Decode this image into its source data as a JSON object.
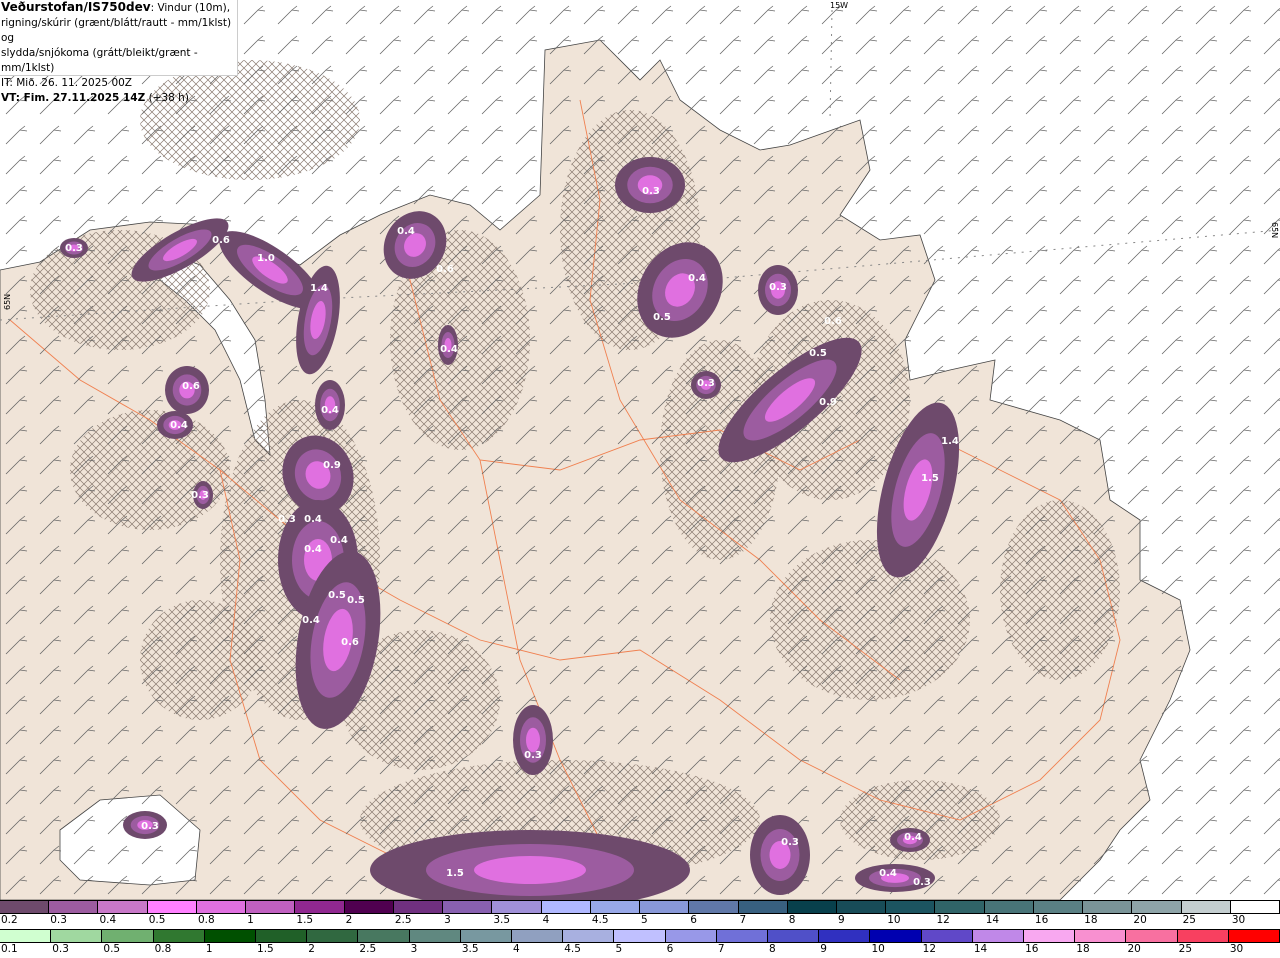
{
  "header": {
    "brand": "Veðurstofan/IS750dev",
    "line1_rest": ": Vindur (10m),",
    "line2": "rigning/skúrir (grænt/blátt/rautt - mm/1klst) og",
    "line3": "slydda/snjókoma (grátt/bleikt/grænt - mm/1klst)",
    "init_time": "IT: Mið. 26. 11. 2025 00Z",
    "valid_label": "VT: Fim. 27.11.2025 14Z",
    "valid_offset": "(+38 h)"
  },
  "map": {
    "graticule_labels": {
      "top": "15W",
      "left": "65N",
      "right": "65N"
    },
    "colors": {
      "land": "#f0e4d8",
      "sea": "#ffffff",
      "roads": "#f08050",
      "wind_barbs": "#555555",
      "hatch": "#8a7a70"
    },
    "precip_values": [
      "0.3",
      "0.6",
      "1.0",
      "1.4",
      "0.4",
      "0.6",
      "0.4",
      "0.6",
      "0.4",
      "0.4",
      "0.9",
      "0.3",
      "0.3",
      "0.4",
      "0.4",
      "0.4",
      "0.5",
      "0.5",
      "0.4",
      "0.6",
      "0.3",
      "0.4",
      "0.5",
      "0.3",
      "0.3",
      "0.6",
      "0.5",
      "0.9",
      "1.4",
      "1.5",
      "0.3",
      "0.3",
      "1.5",
      "0.3",
      "0.4",
      "0.4",
      "0.3"
    ]
  },
  "legend": {
    "snow": {
      "labels": [
        "0.2",
        "0.3",
        "0.4",
        "0.5",
        "0.8",
        "1",
        "1.5",
        "2",
        "2.5",
        "3",
        "3.5",
        "4",
        "4.5",
        "5",
        "6",
        "7",
        "8",
        "9",
        "10",
        "12",
        "14",
        "16",
        "18",
        "20",
        "25",
        "30"
      ],
      "colors": [
        "#6e4a6c",
        "#9c5ca0",
        "#c878c8",
        "#ff80ff",
        "#e070e0",
        "#c060c0",
        "#902890",
        "#500050",
        "#703080",
        "#8860b0",
        "#a090d8",
        "#b0b8ff",
        "#98a8e8",
        "#8898d8",
        "#6078a8",
        "#386080",
        "#08404c",
        "#184c58",
        "#1c5460",
        "#306468",
        "#487478",
        "#5a8084",
        "#7a9498",
        "#8ea4a8",
        "#c4ced0",
        "#ffffff"
      ]
    },
    "rain": {
      "labels": [
        "0.1",
        "0.3",
        "0.5",
        "0.8",
        "1",
        "1.5",
        "2",
        "2.5",
        "3",
        "3.5",
        "4",
        "4.5",
        "5",
        "6",
        "7",
        "8",
        "9",
        "10",
        "12",
        "14",
        "16",
        "18",
        "20",
        "25",
        "30"
      ],
      "colors": [
        "#d0ffd0",
        "#a0d8a0",
        "#70b070",
        "#307830",
        "#005000",
        "#206028",
        "#306840",
        "#487860",
        "#608880",
        "#7898a0",
        "#90a0c0",
        "#a8b0e0",
        "#c0c0ff",
        "#9898e8",
        "#7070d8",
        "#5050c8",
        "#3030c0",
        "#0000b0",
        "#6048c8",
        "#c088e8",
        "#f8a8f0",
        "#f890d0",
        "#f870a0",
        "#f84060",
        "#ff0000"
      ]
    }
  }
}
